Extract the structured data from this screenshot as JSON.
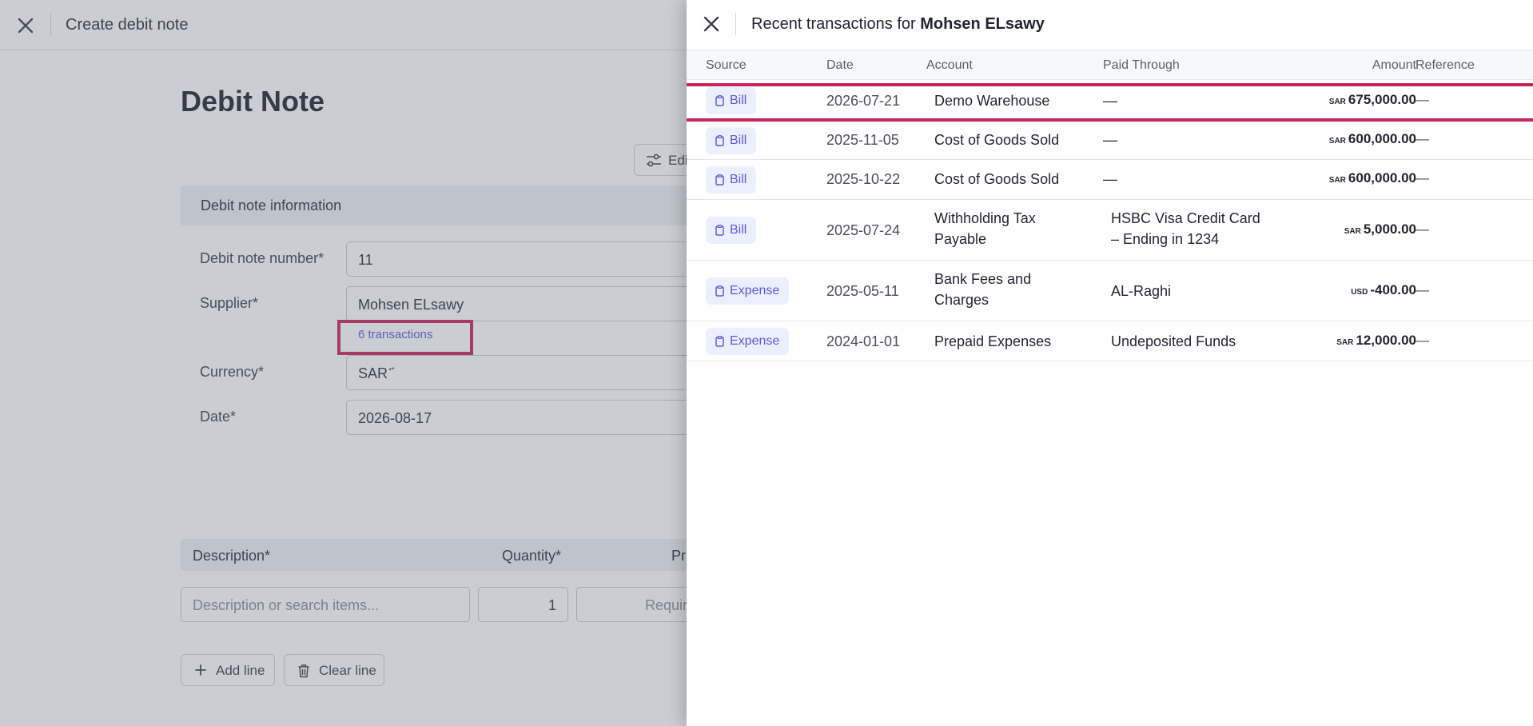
{
  "background": {
    "window_title": "Create debit note",
    "page_title": "Debit Note",
    "edit_button_label": "Edi",
    "section_title": "Debit note information",
    "fields": {
      "debit_note_number_label": "Debit note number*",
      "debit_note_number_value": "11",
      "supplier_label": "Supplier*",
      "supplier_value": "Mohsen ELsawy",
      "transactions_link": "6 transactions",
      "currency_label": "Currency*",
      "currency_value": "SAR ҃",
      "date_label": "Date*",
      "date_value": "2026-08-17"
    },
    "line_items": {
      "col_description": "Description*",
      "col_quantity": "Quantity*",
      "col_price": "Pr",
      "description_placeholder": "Description or search items...",
      "quantity_value": "1",
      "price_placeholder": "Requir"
    },
    "add_line_label": "Add line",
    "clear_line_label": "Clear line"
  },
  "drawer": {
    "title_prefix": "Recent transactions for",
    "title_name": "Mohsen ELsawy",
    "columns": {
      "source": "Source",
      "date": "Date",
      "account": "Account",
      "paid_through": "Paid Through",
      "amount": "Amount",
      "reference": "Reference"
    },
    "rows": [
      {
        "source": "Bill",
        "date": "2026-07-21",
        "account": "Demo Warehouse",
        "paid_through": "—",
        "currency": "SAR",
        "amount": "675,000.00",
        "reference": "—"
      },
      {
        "source": "Bill",
        "date": "2025-11-05",
        "account": "Cost of Goods Sold",
        "paid_through": "—",
        "currency": "SAR",
        "amount": "600,000.00",
        "reference": "—"
      },
      {
        "source": "Bill",
        "date": "2025-10-22",
        "account": "Cost of Goods Sold",
        "paid_through": "—",
        "currency": "SAR",
        "amount": "600,000.00",
        "reference": "—"
      },
      {
        "source": "Bill",
        "date": "2025-07-24",
        "account_line1": "Withholding Tax",
        "account_line2": "Payable",
        "paid_line1": "HSBC Visa Credit Card",
        "paid_line2": "– Ending in 1234",
        "currency": "SAR",
        "amount": "5,000.00",
        "reference": "—"
      },
      {
        "source": "Expense",
        "date": "2025-05-11",
        "account_line1": "Bank Fees and",
        "account_line2": "Charges",
        "paid_through": "AL-Raghi",
        "currency": "USD",
        "amount": "-400.00",
        "reference": "—"
      },
      {
        "source": "Expense",
        "date": "2024-01-01",
        "account": "Prepaid Expenses",
        "paid_through": "Undeposited Funds",
        "currency": "SAR",
        "amount": "12,000.00",
        "reference": "—"
      }
    ]
  },
  "colors": {
    "accent": "#5b5bd6",
    "highlight": "#c8245b",
    "badge_bg": "#eceffe"
  }
}
